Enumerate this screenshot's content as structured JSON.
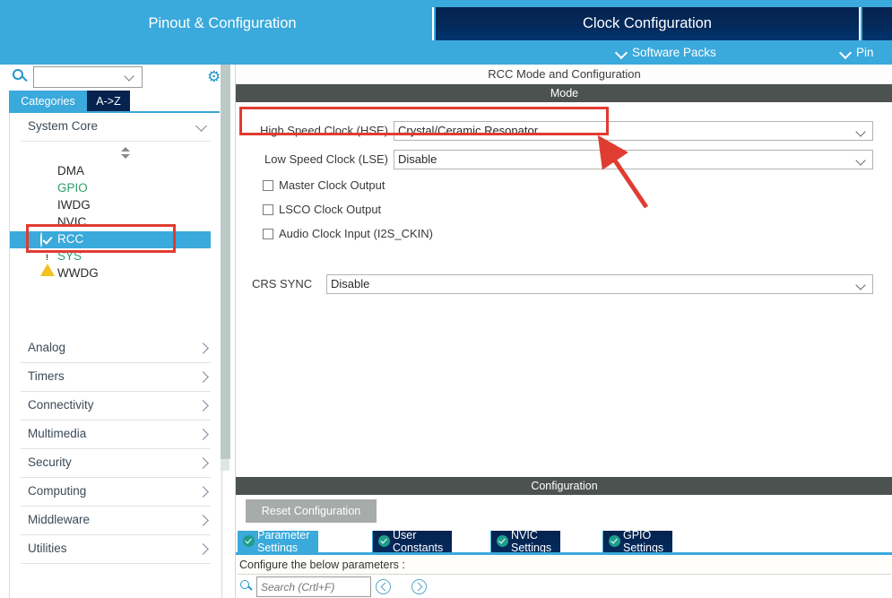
{
  "top_tabs": [
    {
      "label": "Pinout & Configuration",
      "selected": true
    },
    {
      "label": "Clock Configuration",
      "selected": false
    },
    {
      "label": "",
      "selected": false
    }
  ],
  "sub_links": [
    {
      "label": "Software Packs",
      "icon": "chevron-down-icon"
    },
    {
      "label": "Pin",
      "icon": "chevron-down-icon"
    }
  ],
  "sidebar": {
    "search": {
      "value": "",
      "placeholder": "",
      "icon": "search-icon",
      "caret": "chevron-down-icon"
    },
    "gear": "gear-icon",
    "mini_tabs": [
      {
        "label": "Categories",
        "selected": true
      },
      {
        "label": "A->Z",
        "selected": false
      }
    ],
    "groups": [
      {
        "label": "System Core",
        "expanded": true,
        "arrow": "chevron-down-icon"
      },
      {
        "label": "Analog",
        "expanded": false,
        "arrow": "chevron-right-icon"
      },
      {
        "label": "Timers",
        "expanded": false,
        "arrow": "chevron-right-icon"
      },
      {
        "label": "Connectivity",
        "expanded": false,
        "arrow": "chevron-right-icon"
      },
      {
        "label": "Multimedia",
        "expanded": false,
        "arrow": "chevron-right-icon"
      },
      {
        "label": "Security",
        "expanded": false,
        "arrow": "chevron-right-icon"
      },
      {
        "label": "Computing",
        "expanded": false,
        "arrow": "chevron-right-icon"
      },
      {
        "label": "Middleware",
        "expanded": false,
        "arrow": "chevron-right-icon"
      },
      {
        "label": "Utilities",
        "expanded": false,
        "arrow": "chevron-right-icon"
      }
    ],
    "peripherals": [
      {
        "label": "DMA",
        "icon": "none",
        "state": "default",
        "selected": false
      },
      {
        "label": "GPIO",
        "icon": "none",
        "state": "configured",
        "selected": false
      },
      {
        "label": "IWDG",
        "icon": "none",
        "state": "default",
        "selected": false
      },
      {
        "label": "NVIC",
        "icon": "none",
        "state": "configured",
        "selected": false
      },
      {
        "label": "RCC",
        "icon": "check-circle-icon",
        "state": "enabled",
        "selected": true
      },
      {
        "label": "SYS",
        "icon": "warning-triangle-icon",
        "state": "warning",
        "selected": false
      },
      {
        "label": "WWDG",
        "icon": "none",
        "state": "default",
        "selected": false
      }
    ]
  },
  "main": {
    "panel_title": "RCC Mode and Configuration",
    "mode_header": "Mode",
    "config_header": "Configuration",
    "hse": {
      "label": "High Speed Clock (HSE)",
      "value": "Crystal/Ceramic Resonator"
    },
    "lse": {
      "label": "Low Speed Clock (LSE)",
      "value": "Disable"
    },
    "checkboxes": [
      {
        "label": "Master Clock Output",
        "checked": false
      },
      {
        "label": "LSCO Clock Output",
        "checked": false
      },
      {
        "label": "Audio Clock Input (I2S_CKIN)",
        "checked": false
      }
    ],
    "crs": {
      "label": "CRS SYNC",
      "value": "Disable"
    },
    "reset_button": "Reset Configuration",
    "config_tabs": [
      {
        "label": "Parameter Settings",
        "active": true,
        "icon": "check-circle-icon"
      },
      {
        "label": "User Constants",
        "active": false,
        "icon": "check-circle-icon"
      },
      {
        "label": "NVIC Settings",
        "active": false,
        "icon": "check-circle-icon"
      },
      {
        "label": "GPIO Settings",
        "active": false,
        "icon": "check-circle-icon"
      }
    ],
    "config_description": "Configure the below parameters :",
    "config_search": {
      "value": "",
      "placeholder": "Search (Crtl+F)",
      "icon": "search-icon"
    },
    "nav_prev": "chevron-left-circle-icon",
    "nav_next": "chevron-right-circle-icon"
  },
  "colors": {
    "accent_light_blue": "#3aa9db",
    "accent_dark_navy": "#06234f",
    "header_gray": "#4c524f",
    "annotation_red": "#e03c31",
    "ok_green": "#18a558",
    "warn_yellow": "#f2c220",
    "configured_green": "#2e9e6b"
  }
}
